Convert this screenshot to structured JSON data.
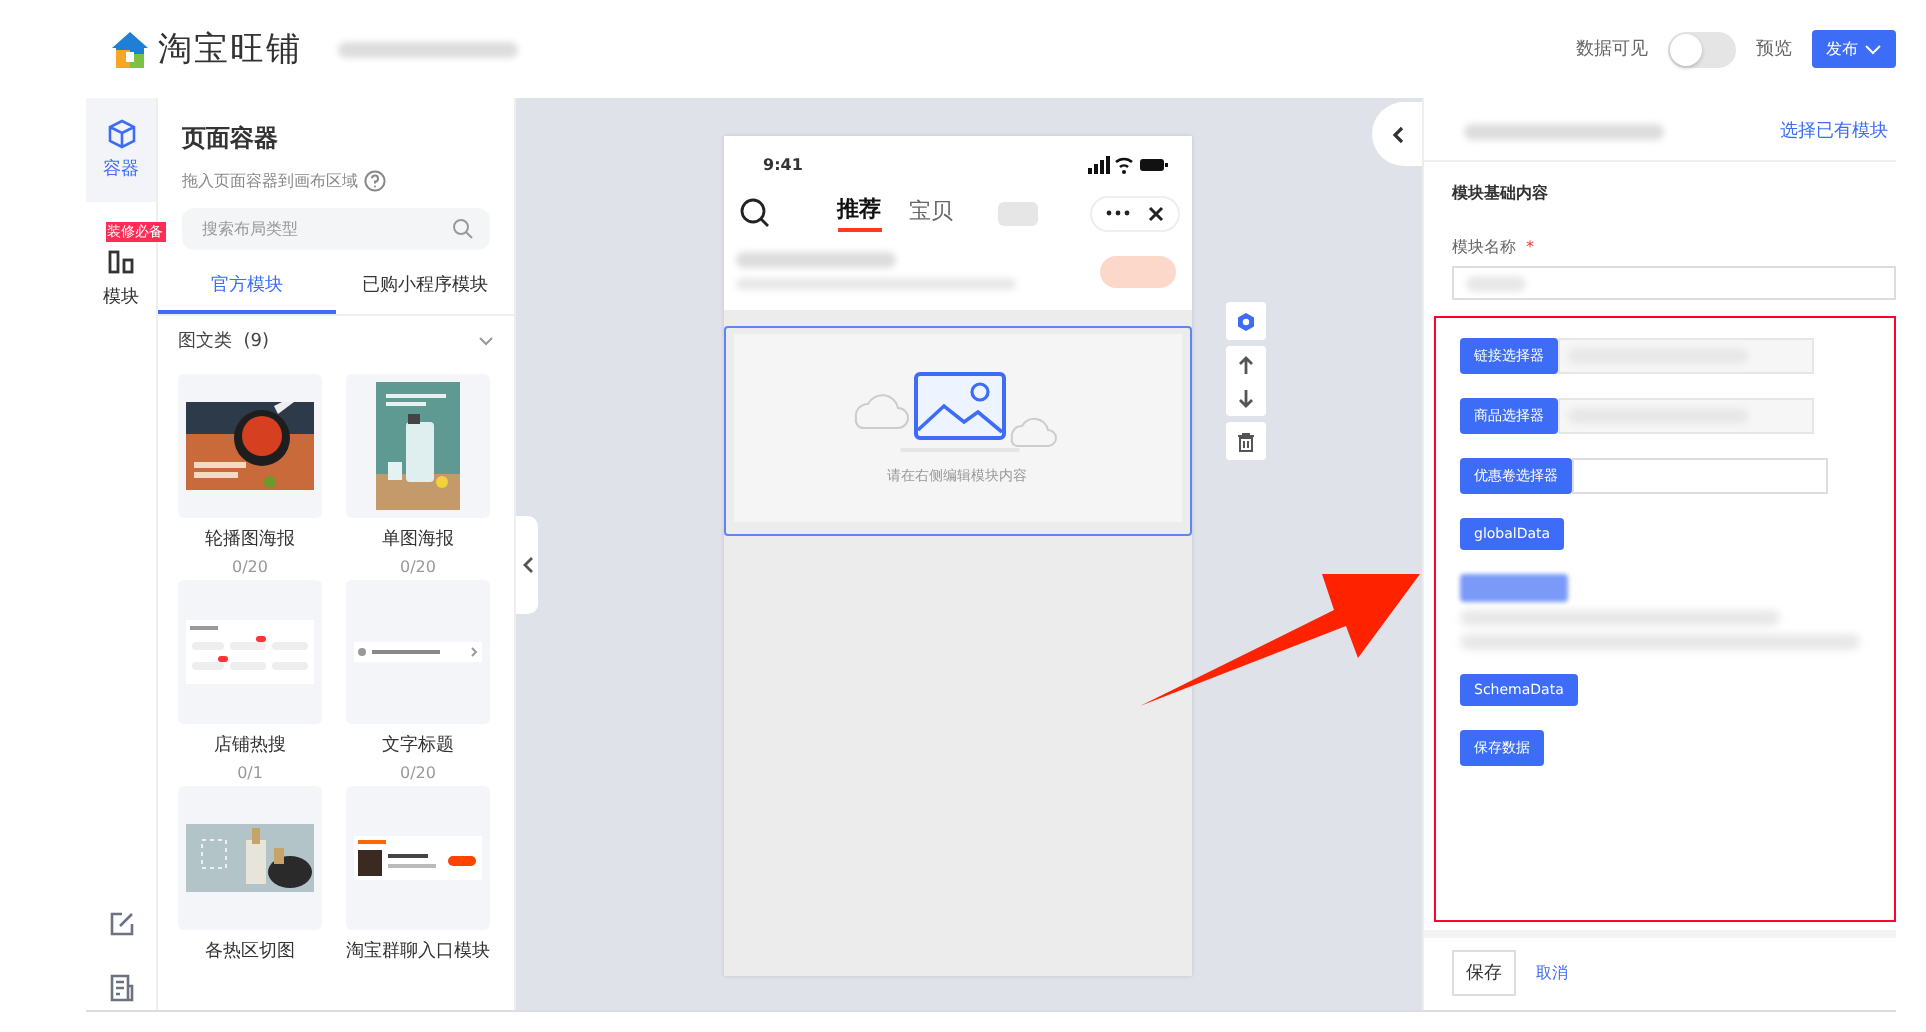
{
  "header": {
    "logo_text": "淘宝旺铺",
    "data_visible": {
      "label": "数据可见",
      "on": false
    },
    "preview": "预览",
    "publish": "发布"
  },
  "rail": {
    "items": [
      {
        "kind": "cube",
        "label": "容器",
        "selected": true
      },
      {
        "kind": "module",
        "label": "模块",
        "selected": false,
        "badge": "装修必备"
      }
    ]
  },
  "library": {
    "title": "页面容器",
    "hint": "拖入页面容器到画布区域",
    "search": {
      "placeholder": "搜索布局类型"
    },
    "tabs": [
      {
        "label": "官方模块",
        "selected": true
      },
      {
        "label": "已购小程序模块",
        "selected": false
      }
    ],
    "group": {
      "label": "图文类",
      "count": "(9)",
      "expanded": true
    },
    "cards": [
      {
        "kind": "soup",
        "name": "轮播图海报",
        "usage": "0/20"
      },
      {
        "kind": "bottle",
        "name": "单图海报",
        "usage": "0/20"
      },
      {
        "kind": "tags",
        "name": "店铺热搜",
        "usage": "0/1"
      },
      {
        "kind": "line",
        "name": "文字标题",
        "usage": "0/20"
      },
      {
        "kind": "hotspot",
        "name": "各热区切图"
      },
      {
        "kind": "group",
        "name": "淘宝群聊入口模块"
      }
    ]
  },
  "phone": {
    "time": "9:41",
    "tabs": [
      {
        "label": "推荐",
        "selected": true
      },
      {
        "label": "宝贝",
        "selected": false
      }
    ],
    "empty_hint": "请在右侧编辑模块内容"
  },
  "editor": {
    "link": "选择已有模块",
    "section": "模块基础内容",
    "field_label": "模块名称",
    "required_mark": "*",
    "rows": [
      {
        "kind": "picker_blurred",
        "label": "链接选择器"
      },
      {
        "kind": "picker_blurred",
        "label": "商品选择器"
      },
      {
        "kind": "picker",
        "label": "优惠卷选择器"
      },
      {
        "kind": "button",
        "label": "globalData"
      },
      {
        "kind": "blurred"
      },
      {
        "kind": "button",
        "label": "SchemaData"
      },
      {
        "kind": "button",
        "label": "保存数据"
      }
    ],
    "footer": {
      "save": "保存",
      "cancel": "取消"
    }
  }
}
